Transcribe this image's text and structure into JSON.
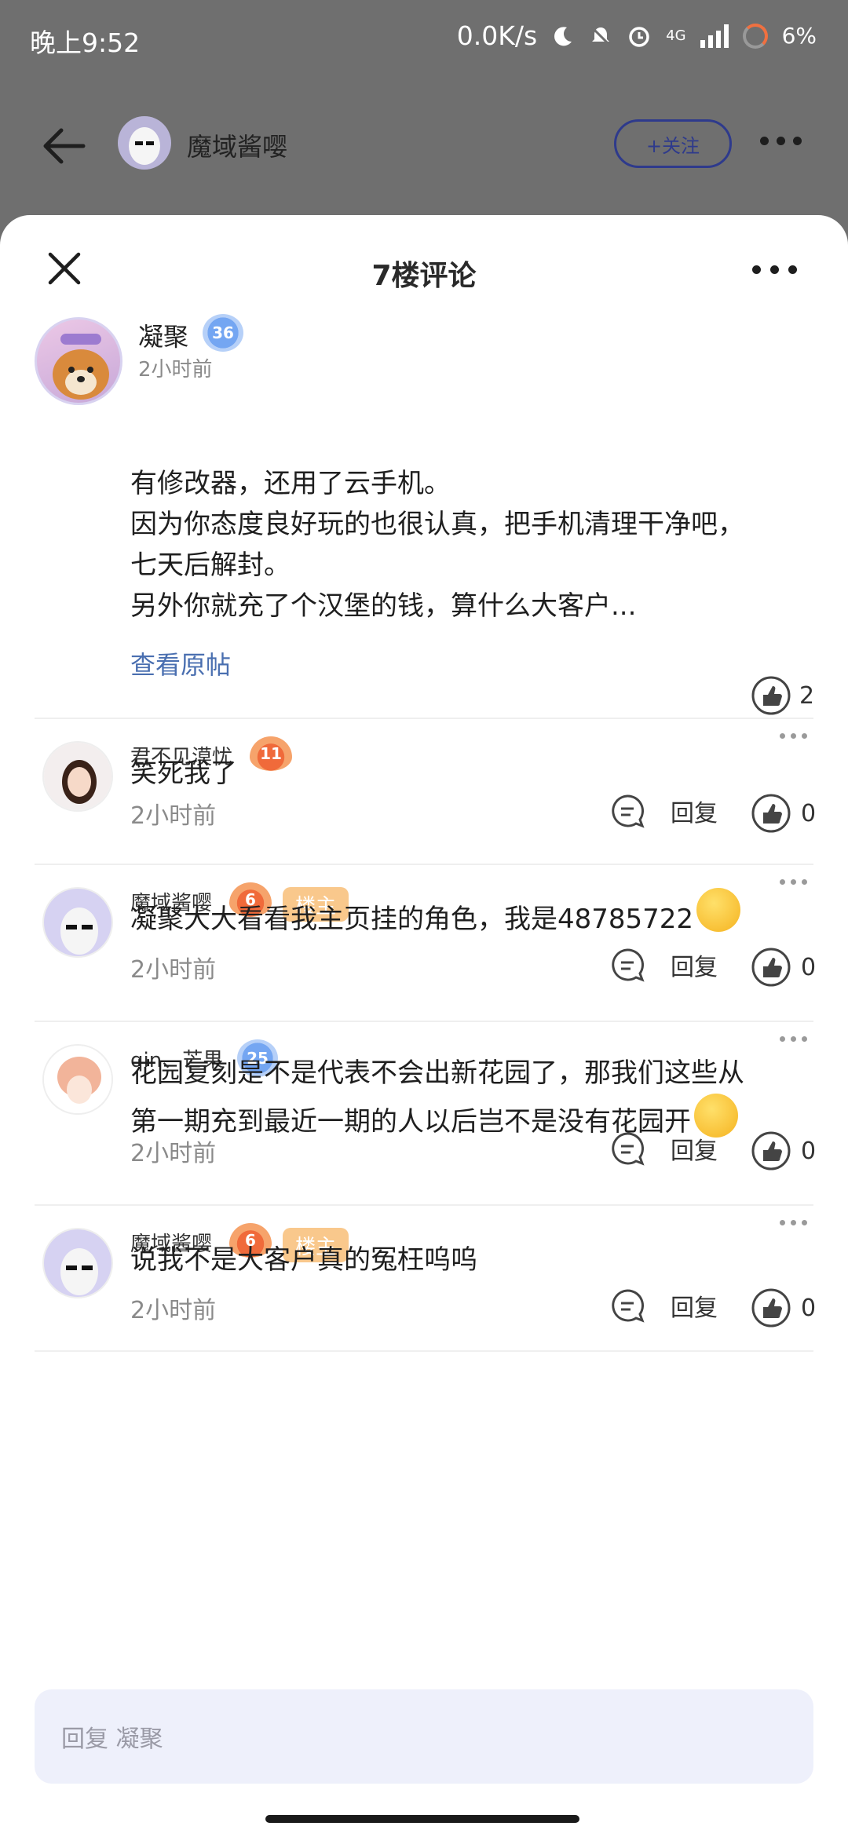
{
  "status_bar": {
    "time": "晚上9:52",
    "net_speed": "0.0K/s",
    "network": "4G",
    "battery": "6%"
  },
  "header": {
    "author_name": "魔域酱嘤",
    "follow_label": "+关注"
  },
  "sheet": {
    "title": "7楼评论"
  },
  "main_comment": {
    "user": "凝聚",
    "level": "36",
    "time": "2小时前",
    "lines": [
      "有修改器，还用了云手机。",
      "因为你态度良好玩的也很认真，把手机清理干净吧，",
      "七天后解封。",
      "另外你就充了个汉堡的钱，算什么大客户..."
    ],
    "view_original": "查看原帖",
    "likes": "2"
  },
  "replies": [
    {
      "user": "君不见漠忧",
      "level": "11",
      "lines": [
        "笑死我了"
      ],
      "time": "2小时前",
      "reply_label": "回复",
      "likes": "0"
    },
    {
      "user": "魔域酱嘤",
      "level": "6",
      "host_badge": "楼主",
      "lines": [
        "凝聚大大看看我主页挂的角色，我是48785722"
      ],
      "time": "2小时前",
      "reply_label": "回复",
      "likes": "0"
    },
    {
      "user": "qin、芒果",
      "level": "25",
      "lines": [
        "花园复刻是不是代表不会出新花园了，那我们这些从",
        "第一期充到最近一期的人以后岂不是没有花园开"
      ],
      "time": "2小时前",
      "reply_label": "回复",
      "likes": "0"
    },
    {
      "user": "魔域酱嘤",
      "level": "6",
      "host_badge": "楼主",
      "lines": [
        "说我不是大客户真的冤枉呜呜"
      ],
      "time": "2小时前",
      "reply_label": "回复",
      "likes": "0"
    }
  ],
  "input": {
    "placeholder": "回复 凝聚"
  },
  "icons": {
    "back": "back-arrow-icon",
    "close": "close-icon",
    "more": "more-dots-icon",
    "comment": "comment-bubble-icon",
    "like": "thumbs-up-icon"
  },
  "colors": {
    "link": "#4a6fb0",
    "host_badge": "#f9c88c",
    "input_bg": "#eef0fb"
  }
}
